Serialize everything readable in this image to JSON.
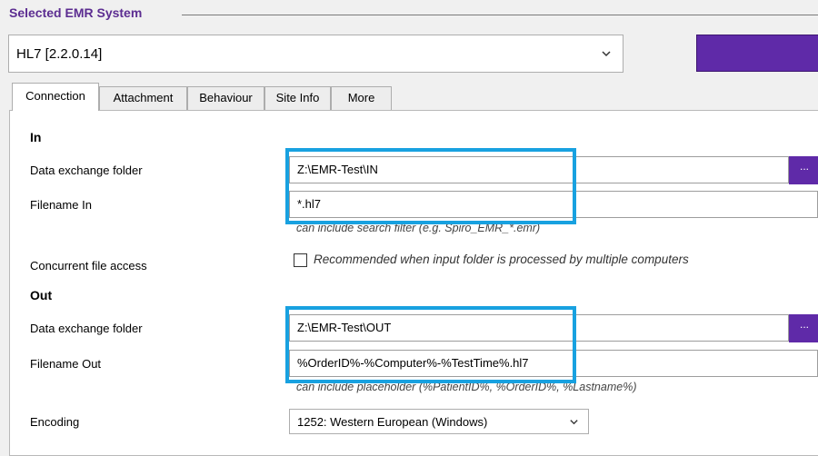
{
  "group": {
    "title": "Selected EMR System"
  },
  "system_select": {
    "value": "HL7 [2.2.0.14]"
  },
  "tabs": [
    {
      "label": "Connection",
      "active": true
    },
    {
      "label": "Attachment",
      "active": false
    },
    {
      "label": "Behaviour",
      "active": false
    },
    {
      "label": "Site Info",
      "active": false
    },
    {
      "label": "More",
      "active": false
    }
  ],
  "in_section": {
    "title": "In",
    "data_folder_label": "Data exchange folder",
    "data_folder_value": "Z:\\EMR-Test\\IN",
    "filename_label": "Filename In",
    "filename_value": "*.hl7",
    "filename_hint": "can include search filter (e.g. Spiro_EMR_*.emr)",
    "browse_label": "..."
  },
  "concurrent": {
    "label": "Concurrent file access",
    "checkbox_text": "Recommended when input folder is processed by multiple computers",
    "checked": false
  },
  "out_section": {
    "title": "Out",
    "data_folder_label": "Data exchange folder",
    "data_folder_value": "Z:\\EMR-Test\\OUT",
    "filename_label": "Filename Out",
    "filename_value": "%OrderID%-%Computer%-%TestTime%.hl7",
    "filename_hint": "can include placeholder (%PatientID%, %OrderID%, %Lastname%)",
    "browse_label": "..."
  },
  "encoding": {
    "label": "Encoding",
    "value": "1252: Western European (Windows)"
  },
  "colors": {
    "accent": "#5f2aa8",
    "highlight": "#18a1e0",
    "group_title": "#5c2d91"
  }
}
